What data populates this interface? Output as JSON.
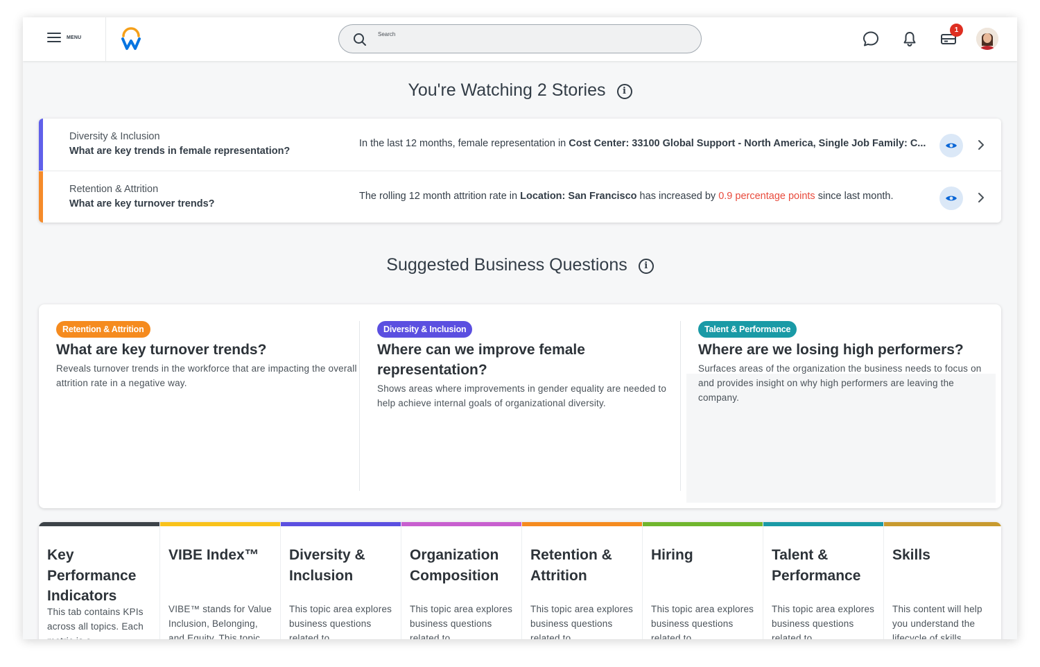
{
  "header": {
    "menu_label": "MENU",
    "search": {
      "placeholder": "Search"
    },
    "inbox_badge": "1",
    "icons": [
      "chat-icon",
      "bell-icon",
      "inbox-icon"
    ]
  },
  "watching": {
    "title": "You're Watching 2 Stories",
    "stories": [
      {
        "category": "Diversity & Inclusion",
        "question": "What are key trends in female representation?",
        "text_pre": "In the last 12 months, female representation in ",
        "text_bold": "Cost Center: 33100 Global Support - North America, Single Job Family: C...",
        "text_mid": "",
        "text_red": "",
        "text_post": "",
        "stripe_color": "#6060ea"
      },
      {
        "category": "Retention & Attrition",
        "question": "What are key turnover trends?",
        "text_pre": "The rolling 12 month attrition rate in ",
        "text_bold": "Location: San Francisco",
        "text_mid": " has increased by ",
        "text_red": "0.9 percentage points",
        "text_post": " since last month.",
        "stripe_color": "#f58b2a"
      }
    ]
  },
  "suggested": {
    "title": "Suggested Business Questions",
    "cards": [
      {
        "tag": "Retention & Attrition",
        "tag_color": "#f58b1f",
        "title": "What are key turnover trends?",
        "desc": "Reveals turnover trends in the workforce that are impacting the overall attrition rate in a negative way."
      },
      {
        "tag": "Diversity & Inclusion",
        "tag_color": "#5b4fe0",
        "title": "Where can we improve female representation?",
        "desc": "Shows areas where improvements in gender equality are needed to help achieve internal goals of organizational diversity."
      },
      {
        "tag": "Talent & Performance",
        "tag_color": "#1a9aa6",
        "title": "Where are we losing high performers?",
        "desc": "Surfaces areas of the organization the business needs to focus on and provides insight on why high performers are leaving the company."
      }
    ]
  },
  "topics": [
    {
      "title": "Key Performance Indicators",
      "desc": "This tab contains KPIs across all topics. Each metric is a...",
      "color": "#3d4348"
    },
    {
      "title": "VIBE Index™",
      "desc": "VIBE™ stands for Value Inclusion, Belonging, and Equity. This topic...",
      "color": "#f9c21a"
    },
    {
      "title": "Diversity & Inclusion",
      "desc": "This topic area explores business questions related to...",
      "color": "#5b4fe0"
    },
    {
      "title": "Organization Composition",
      "desc": "This topic area explores business questions related to...",
      "color": "#c85fcf"
    },
    {
      "title": "Retention & Attrition",
      "desc": "This topic area explores business questions related to...",
      "color": "#f58b1f"
    },
    {
      "title": "Hiring",
      "desc": "This topic area explores business questions related to...",
      "color": "#70b62d"
    },
    {
      "title": "Talent & Performance",
      "desc": "This topic area explores business questions related to...",
      "color": "#1a9aa6"
    },
    {
      "title": "Skills",
      "desc": "This content will help you understand the lifecycle of skills...",
      "color": "#c89a2e"
    }
  ]
}
